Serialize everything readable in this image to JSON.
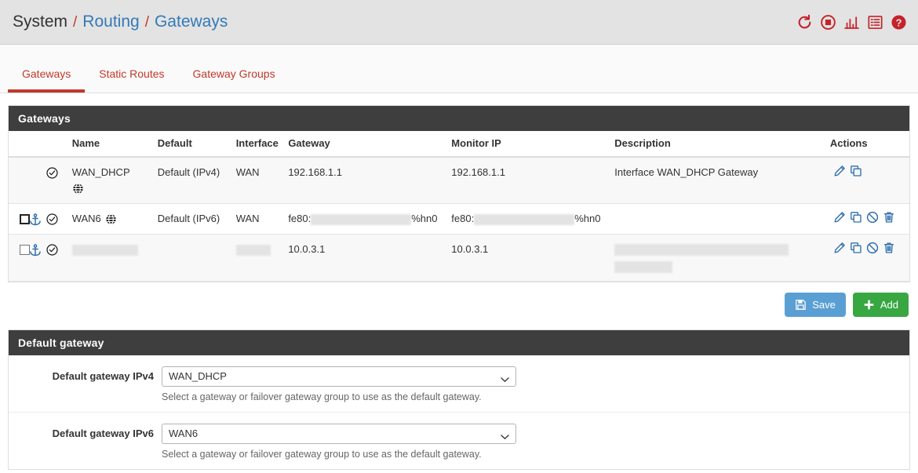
{
  "breadcrumb": {
    "root": "System",
    "sep": "/",
    "middle": "Routing",
    "current": "Gateways"
  },
  "header_icons": [
    {
      "name": "refresh-icon",
      "title": "Refresh"
    },
    {
      "name": "stop-icon",
      "title": "Stop"
    },
    {
      "name": "chart-icon",
      "title": "Status Graph"
    },
    {
      "name": "list-icon",
      "title": "Log"
    },
    {
      "name": "help-icon",
      "title": "Help"
    }
  ],
  "tabs": [
    {
      "label": "Gateways",
      "active": true
    },
    {
      "label": "Static Routes",
      "active": false
    },
    {
      "label": "Gateway Groups",
      "active": false
    }
  ],
  "gateways_panel": {
    "title": "Gateways",
    "columns": [
      "Name",
      "Default",
      "Interface",
      "Gateway",
      "Monitor IP",
      "Description",
      "Actions"
    ],
    "rows": [
      {
        "selectable": false,
        "checkbox_focused": false,
        "anchor": false,
        "status": "online",
        "name": "WAN_DHCP",
        "name_redacted": false,
        "name_icon": "globe-icon",
        "name_icon_below": true,
        "default": "Default (IPv4)",
        "interface": "WAN",
        "interface_redacted": false,
        "gateway": "192.168.1.1",
        "gateway_redacted": false,
        "monitor_ip": "192.168.1.1",
        "monitor_redacted": false,
        "description": "Interface WAN_DHCP Gateway",
        "description_redacted": false,
        "actions": [
          "edit-icon",
          "copy-icon"
        ]
      },
      {
        "selectable": true,
        "checkbox_focused": true,
        "anchor": true,
        "status": "online",
        "name": "WAN6",
        "name_redacted": false,
        "name_icon": "globe-icon",
        "name_icon_below": false,
        "default": "Default (IPv6)",
        "interface": "WAN",
        "interface_redacted": false,
        "gateway": "fe80:",
        "gateway_suffix": "%hn0",
        "gateway_redacted": true,
        "monitor_ip": "fe80:",
        "monitor_suffix": "%hn0",
        "monitor_redacted": true,
        "description": "",
        "description_redacted": false,
        "actions": [
          "edit-icon",
          "copy-icon",
          "disable-icon",
          "delete-icon"
        ]
      },
      {
        "selectable": true,
        "checkbox_focused": false,
        "anchor": true,
        "status": "online",
        "name": "",
        "name_redacted": true,
        "name_icon": null,
        "name_icon_below": false,
        "default": "",
        "interface": "",
        "interface_redacted": true,
        "gateway": "10.0.3.1",
        "gateway_redacted": false,
        "monitor_ip": "10.0.3.1",
        "monitor_redacted": false,
        "description": "",
        "description_redacted": true,
        "actions": [
          "edit-icon",
          "copy-icon",
          "disable-icon",
          "delete-icon"
        ]
      }
    ]
  },
  "buttons": {
    "save": "Save",
    "add": "Add"
  },
  "default_gateway_panel": {
    "title": "Default gateway",
    "fields": [
      {
        "label": "Default gateway IPv4",
        "value": "WAN_DHCP",
        "help": "Select a gateway or failover gateway group to use as the default gateway."
      },
      {
        "label": "Default gateway IPv6",
        "value": "WAN6",
        "help": "Select a gateway or failover gateway group to use as the default gateway."
      }
    ]
  },
  "colors": {
    "accent_red": "#c0392b",
    "link_blue": "#337ab7",
    "panel_header": "#3e3e3e",
    "icon_blue": "#2f6fad",
    "save_blue": "#5a9fd4",
    "add_green": "#38a742"
  }
}
